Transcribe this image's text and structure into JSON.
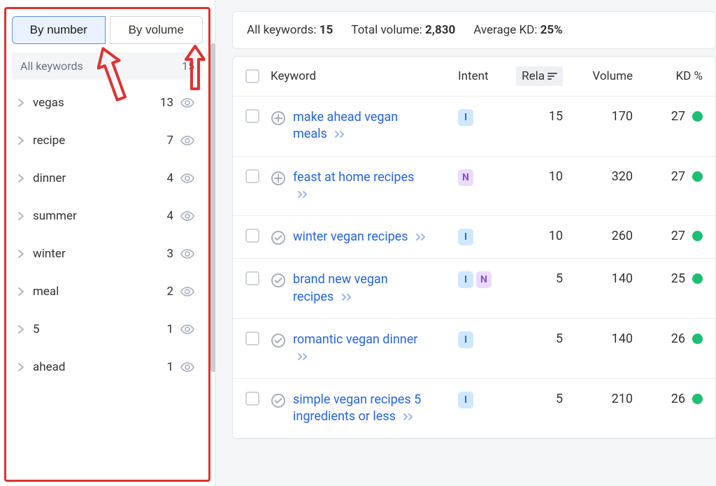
{
  "sidebar": {
    "tabs": {
      "by_number": "By number",
      "by_volume": "By volume"
    },
    "all_keywords_label": "All keywords",
    "all_keywords_count": "15",
    "items": [
      {
        "label": "vegas",
        "count": "13"
      },
      {
        "label": "recipe",
        "count": "7"
      },
      {
        "label": "dinner",
        "count": "4"
      },
      {
        "label": "summer",
        "count": "4"
      },
      {
        "label": "winter",
        "count": "3"
      },
      {
        "label": "meal",
        "count": "2"
      },
      {
        "label": "5",
        "count": "1"
      },
      {
        "label": "ahead",
        "count": "1"
      }
    ]
  },
  "summary": {
    "all_keywords_label": "All keywords:",
    "all_keywords_value": "15",
    "total_volume_label": "Total volume:",
    "total_volume_value": "2,830",
    "avg_kd_label": "Average KD:",
    "avg_kd_value": "25%"
  },
  "table": {
    "headers": {
      "keyword": "Keyword",
      "intent": "Intent",
      "related": "Rela",
      "volume": "Volume",
      "kd": "KD %"
    },
    "rows": [
      {
        "icon": "plus",
        "keyword": "make ahead vegan meals",
        "intents": [
          "I"
        ],
        "related": "15",
        "volume": "170",
        "kd": "27"
      },
      {
        "icon": "plus",
        "keyword": "feast at home recipes",
        "intents": [
          "N"
        ],
        "related": "10",
        "volume": "320",
        "kd": "27"
      },
      {
        "icon": "check",
        "keyword": "winter vegan recipes",
        "intents": [
          "I"
        ],
        "related": "10",
        "volume": "260",
        "kd": "27"
      },
      {
        "icon": "check",
        "keyword": "brand new vegan recipes",
        "intents": [
          "I",
          "N"
        ],
        "related": "5",
        "volume": "140",
        "kd": "25"
      },
      {
        "icon": "check",
        "keyword": "romantic vegan dinner",
        "intents": [
          "I"
        ],
        "related": "5",
        "volume": "140",
        "kd": "26"
      },
      {
        "icon": "check",
        "keyword": "simple vegan recipes 5 ingredients or less",
        "intents": [
          "I"
        ],
        "related": "5",
        "volume": "210",
        "kd": "26"
      }
    ]
  }
}
